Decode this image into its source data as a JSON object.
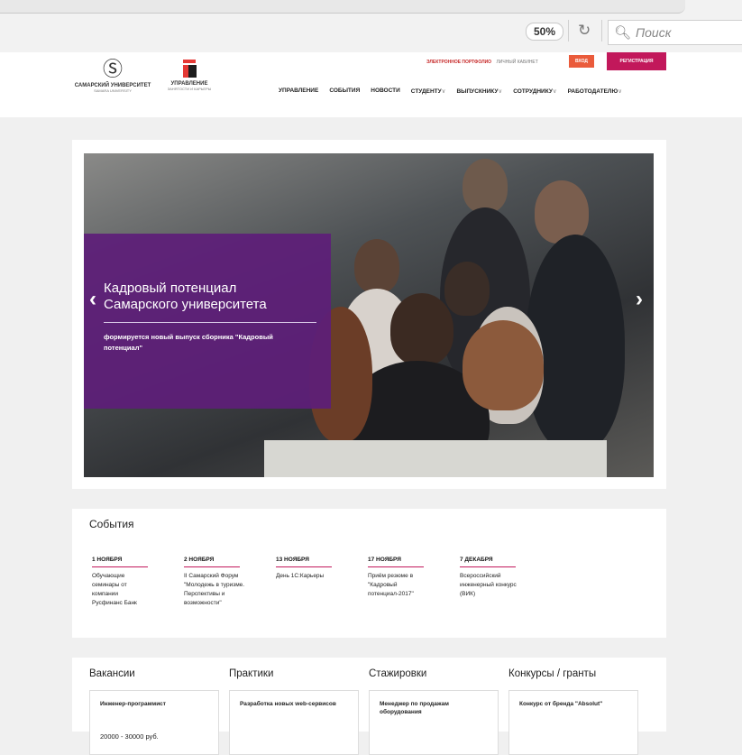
{
  "browser": {
    "zoom": "50%",
    "search_placeholder": "Поиск"
  },
  "header": {
    "logo1_line1": "САМАРСКИЙ УНИВЕРСИТЕТ",
    "logo1_line2": "SAMARA UNIVERSITY",
    "logo2_line1": "УПРАВЛЕНИЕ",
    "logo2_line2": "ЗАНЯТОСТИ И КАРЬЕРЫ",
    "portfolio_link": "ЭЛЕКТРОННОЕ ПОРТФОЛИО",
    "cabinet_link": "ЛИЧНЫЙ КАБИНЕТ",
    "login_label": "ВХОД",
    "register_label": "РЕГИСТРАЦИЯ",
    "nav": [
      {
        "label": "УПРАВЛЕНИЕ",
        "dropdown": false
      },
      {
        "label": "СОБЫТИЯ",
        "dropdown": false
      },
      {
        "label": "НОВОСТИ",
        "dropdown": false
      },
      {
        "label": "СТУДЕНТУ",
        "dropdown": true
      },
      {
        "label": "ВЫПУСКНИКУ",
        "dropdown": true
      },
      {
        "label": "СОТРУДНИКУ",
        "dropdown": true
      },
      {
        "label": "РАБОТОДАТЕЛЮ",
        "dropdown": true
      }
    ]
  },
  "slider": {
    "title_line1": "Кадровый потенциал",
    "title_line2": "Самарского университета",
    "description": "формируется новый выпуск сборника \"Кадровый потенциал\"",
    "prev_icon": "chevron-left-icon",
    "next_icon": "chevron-right-icon"
  },
  "events": {
    "heading": "События",
    "items": [
      {
        "date": "1 НОЯБРЯ",
        "text": "Обучающие семинары от компании Русфинанс Банк"
      },
      {
        "date": "2 НОЯБРЯ",
        "text": "II Самарский Форум \"Молодежь в туризме. Перспективы и возможности\""
      },
      {
        "date": "13 НОЯБРЯ",
        "text": "День 1С:Карьеры"
      },
      {
        "date": "17 НОЯБРЯ",
        "text": "Приём резюме в \"Кадровый потенциал-2017\""
      },
      {
        "date": "7 ДЕКАБРЯ",
        "text": "Всероссийский инженерный конкурс (ВИК)"
      }
    ]
  },
  "jobs": {
    "columns": [
      {
        "heading": "Вакансии",
        "card_title": "Инженер-программист",
        "salary": "20000 - 30000 руб."
      },
      {
        "heading": "Практики",
        "card_title": "Разработка новых web-сервисов",
        "salary": ""
      },
      {
        "heading": "Стажировки",
        "card_title": "Менеджер по продажам оборудования",
        "salary": ""
      },
      {
        "heading": "Конкурсы / гранты",
        "card_title": "Конкурс от бренда \"Absolut\"",
        "salary": ""
      }
    ]
  },
  "colors": {
    "accent_purple": "#5e1e78",
    "register_button": "#c2185b",
    "login_button": "#ea5b3b",
    "event_underline": "#c2185b"
  }
}
